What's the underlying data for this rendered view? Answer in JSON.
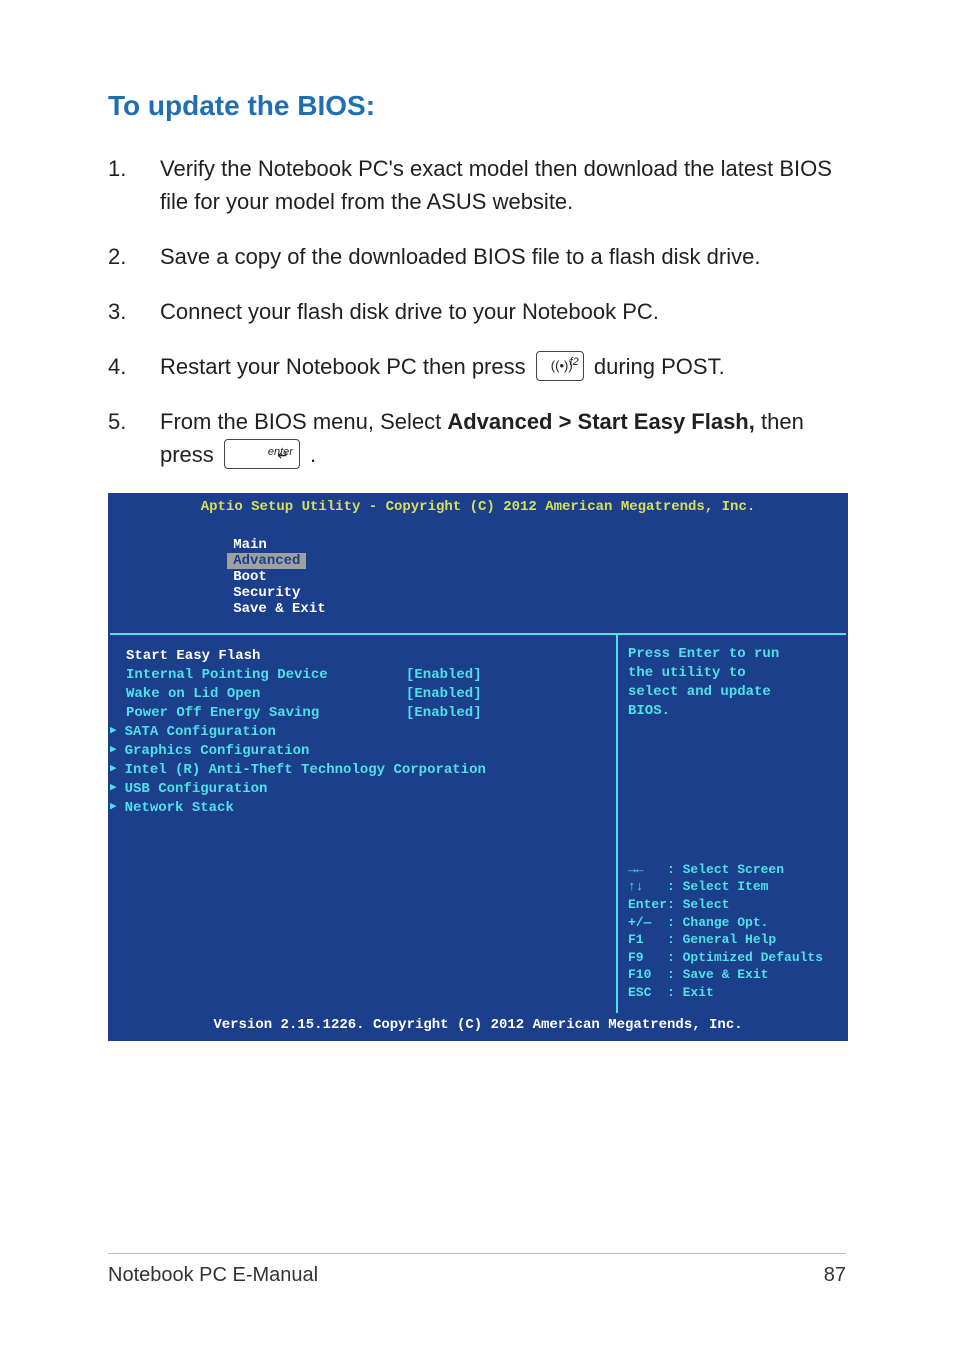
{
  "heading": "To update the BIOS:",
  "steps": [
    {
      "num": "1.",
      "text": "Verify the Notebook PC's exact model then download the latest BIOS file for your model from the ASUS website."
    },
    {
      "num": "2.",
      "text": "Save a copy of the downloaded BIOS file to a flash disk drive."
    },
    {
      "num": "3.",
      "text": "Connect your flash disk drive to your Notebook PC."
    },
    {
      "num": "4.",
      "pre": "Restart your Notebook PC then press ",
      "key": "f2",
      "post": " during POST."
    },
    {
      "num": "5.",
      "pre": "From the BIOS menu, Select ",
      "bold": "Advanced > Start Easy Flash,",
      "mid": " then press ",
      "key": "enter",
      "post": "."
    }
  ],
  "keys": {
    "f2_label": "f2",
    "f2_sym": "((•))",
    "enter_label": "enter",
    "enter_arrow": "↵"
  },
  "bios": {
    "title": "Aptio Setup Utility - Copyright (C) 2012 American Megatrends, Inc.",
    "tabs": [
      "Main",
      "Advanced",
      "Boot",
      "Security",
      "Save & Exit"
    ],
    "active_tab_index": 1,
    "rows": [
      {
        "type": "sel",
        "k": "Start Easy Flash",
        "v": ""
      },
      {
        "type": "kv",
        "k": "Internal Pointing Device",
        "v": "[Enabled]"
      },
      {
        "type": "kv",
        "k": "Wake on Lid Open",
        "v": "[Enabled]"
      },
      {
        "type": "kv",
        "k": "Power Off Energy Saving",
        "v": "[Enabled]"
      },
      {
        "type": "sub",
        "k": "SATA Configuration",
        "v": ""
      },
      {
        "type": "sub",
        "k": "Graphics Configuration",
        "v": ""
      },
      {
        "type": "sub",
        "k": "Intel (R) Anti-Theft Technology Corporation",
        "v": ""
      },
      {
        "type": "sub",
        "k": "USB Configuration",
        "v": ""
      },
      {
        "type": "sub",
        "k": "Network Stack",
        "v": ""
      }
    ],
    "help_top": "Press Enter to run\nthe utility to\nselect and update\nBIOS.",
    "help_keys": "→←   : Select Screen\n↑↓   : Select Item\nEnter: Select\n+/—  : Change Opt.\nF1   : General Help\nF9   : Optimized Defaults\nF10  : Save & Exit\nESC  : Exit",
    "footer": "Version 2.15.1226. Copyright (C) 2012 American Megatrends, Inc."
  },
  "footer": {
    "left": "Notebook PC E-Manual",
    "right": "87"
  }
}
